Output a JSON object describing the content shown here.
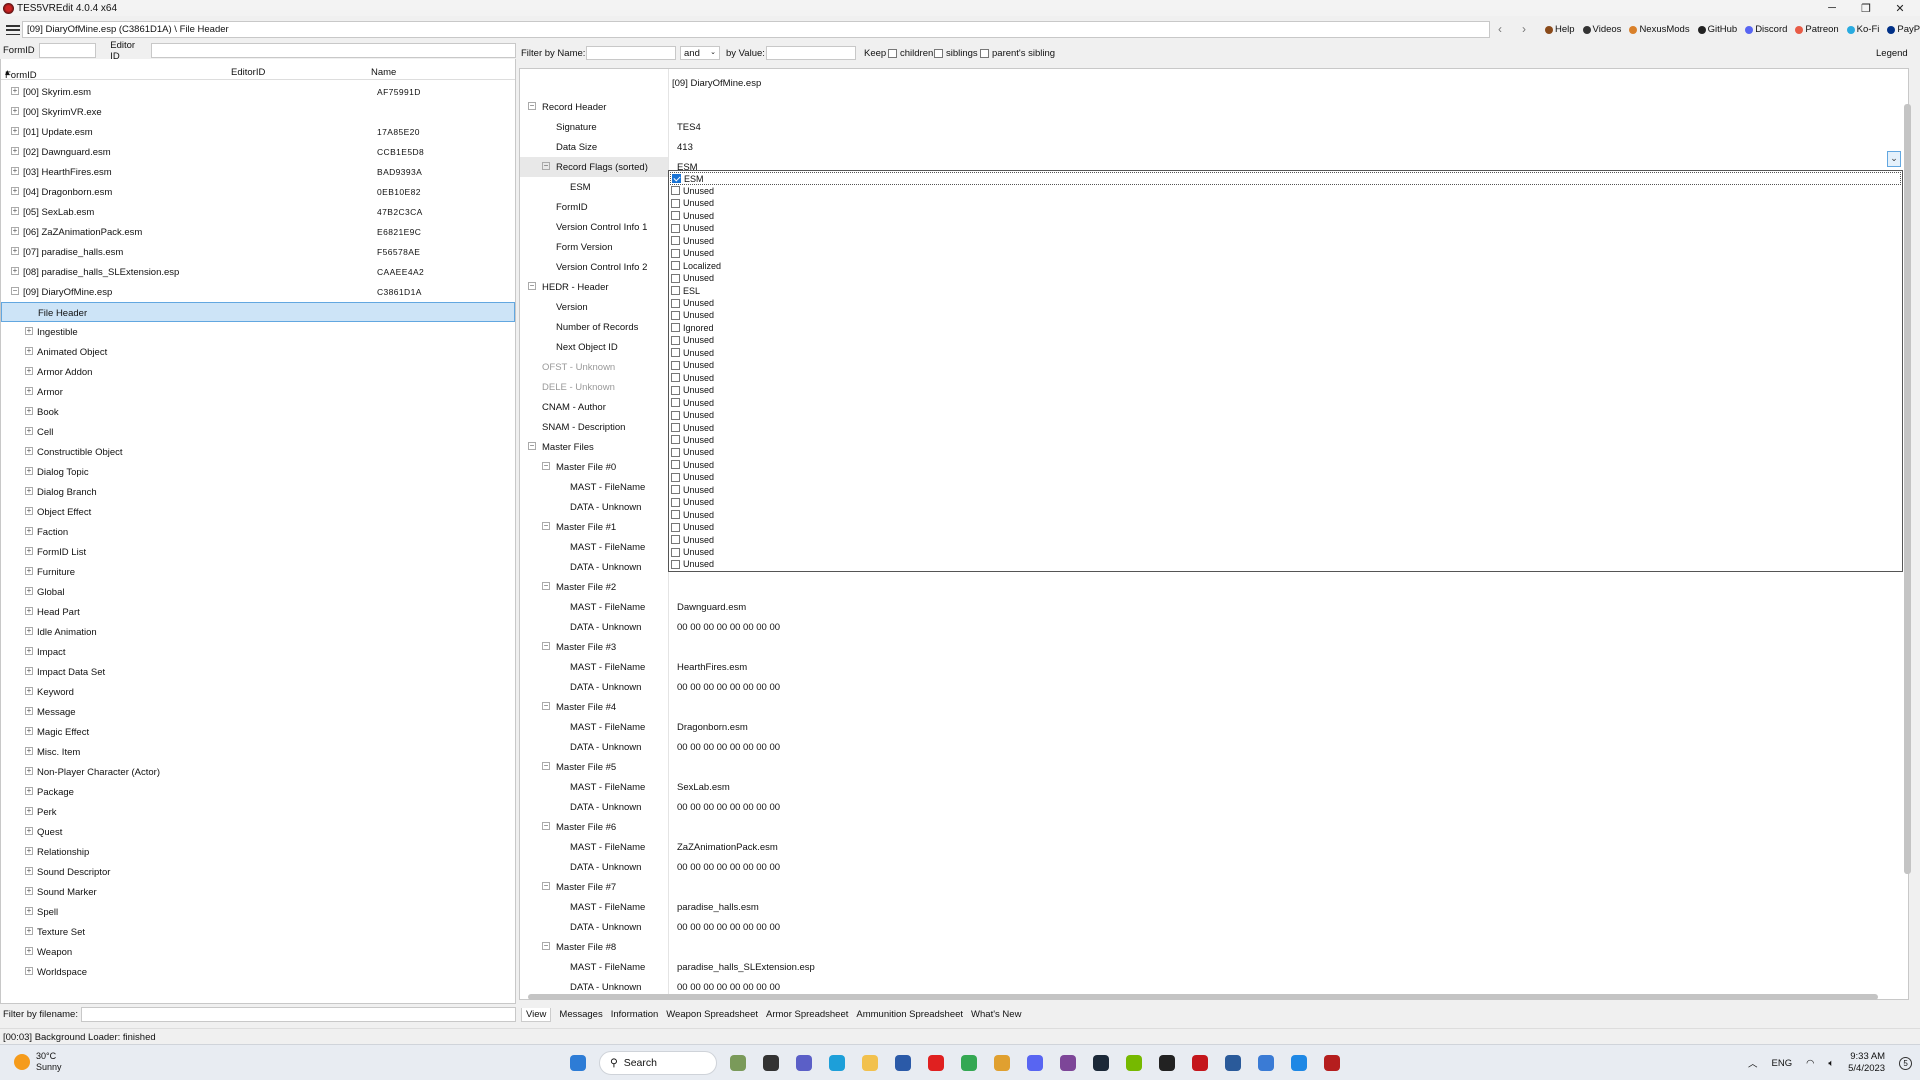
{
  "window": {
    "title": "TES5VREdit 4.0.4 x64"
  },
  "toolbar": {
    "path": "[09] DiaryOfMine.esp (C3861D1A) \\ File Header",
    "links": [
      {
        "label": "Help",
        "icon": "help-icon",
        "color": "#8a4a1a"
      },
      {
        "label": "Videos",
        "icon": "videos-icon",
        "color": "#333333"
      },
      {
        "label": "NexusMods",
        "icon": "nexusmods-icon",
        "color": "#d9802a"
      },
      {
        "label": "GitHub",
        "icon": "github-icon",
        "color": "#222222"
      },
      {
        "label": "Discord",
        "icon": "discord-icon",
        "color": "#5865f2"
      },
      {
        "label": "Patreon",
        "icon": "patreon-icon",
        "color": "#e85b46"
      },
      {
        "label": "Ko-Fi",
        "icon": "kofi-icon",
        "color": "#29abe0"
      },
      {
        "label": "PayPal",
        "icon": "paypal-icon",
        "color": "#003087"
      }
    ]
  },
  "left_filter": {
    "formid_label": "FormID",
    "editorid_label": "Editor ID"
  },
  "left_columns": {
    "formid": "FormID",
    "editorid": "EditorID",
    "name": "Name"
  },
  "tree": [
    {
      "label": "[00] Skyrim.esm",
      "fid": "AF75991D",
      "level": 0,
      "expander": "+"
    },
    {
      "label": "[00] SkyrimVR.exe",
      "fid": "",
      "level": 0,
      "expander": "+"
    },
    {
      "label": "[01] Update.esm",
      "fid": "17A85E20",
      "level": 0,
      "expander": "+"
    },
    {
      "label": "[02] Dawnguard.esm",
      "fid": "CCB1E5D8",
      "level": 0,
      "expander": "+"
    },
    {
      "label": "[03] HearthFires.esm",
      "fid": "BAD9393A",
      "level": 0,
      "expander": "+"
    },
    {
      "label": "[04] Dragonborn.esm",
      "fid": "0EB10E82",
      "level": 0,
      "expander": "+"
    },
    {
      "label": "[05] SexLab.esm",
      "fid": "47B2C3CA",
      "level": 0,
      "expander": "+"
    },
    {
      "label": "[06] ZaZAnimationPack.esm",
      "fid": "E6821E9C",
      "level": 0,
      "expander": "+"
    },
    {
      "label": "[07] paradise_halls.esm",
      "fid": "F56578AE",
      "level": 0,
      "expander": "+"
    },
    {
      "label": "[08] paradise_halls_SLExtension.esp",
      "fid": "CAAEE4A2",
      "level": 0,
      "expander": "+"
    },
    {
      "label": "[09] DiaryOfMine.esp",
      "fid": "C3861D1A",
      "level": 0,
      "expander": "−"
    },
    {
      "label": "File Header",
      "fid": "",
      "level": 1,
      "expander": "",
      "selected": true
    },
    {
      "label": "Ingestible",
      "fid": "",
      "level": 1,
      "expander": "+"
    },
    {
      "label": "Animated Object",
      "fid": "",
      "level": 1,
      "expander": "+"
    },
    {
      "label": "Armor Addon",
      "fid": "",
      "level": 1,
      "expander": "+"
    },
    {
      "label": "Armor",
      "fid": "",
      "level": 1,
      "expander": "+"
    },
    {
      "label": "Book",
      "fid": "",
      "level": 1,
      "expander": "+"
    },
    {
      "label": "Cell",
      "fid": "",
      "level": 1,
      "expander": "+"
    },
    {
      "label": "Constructible Object",
      "fid": "",
      "level": 1,
      "expander": "+"
    },
    {
      "label": "Dialog Topic",
      "fid": "",
      "level": 1,
      "expander": "+"
    },
    {
      "label": "Dialog Branch",
      "fid": "",
      "level": 1,
      "expander": "+"
    },
    {
      "label": "Object Effect",
      "fid": "",
      "level": 1,
      "expander": "+"
    },
    {
      "label": "Faction",
      "fid": "",
      "level": 1,
      "expander": "+"
    },
    {
      "label": "FormID List",
      "fid": "",
      "level": 1,
      "expander": "+"
    },
    {
      "label": "Furniture",
      "fid": "",
      "level": 1,
      "expander": "+"
    },
    {
      "label": "Global",
      "fid": "",
      "level": 1,
      "expander": "+"
    },
    {
      "label": "Head Part",
      "fid": "",
      "level": 1,
      "expander": "+"
    },
    {
      "label": "Idle Animation",
      "fid": "",
      "level": 1,
      "expander": "+"
    },
    {
      "label": "Impact",
      "fid": "",
      "level": 1,
      "expander": "+"
    },
    {
      "label": "Impact Data Set",
      "fid": "",
      "level": 1,
      "expander": "+"
    },
    {
      "label": "Keyword",
      "fid": "",
      "level": 1,
      "expander": "+"
    },
    {
      "label": "Message",
      "fid": "",
      "level": 1,
      "expander": "+"
    },
    {
      "label": "Magic Effect",
      "fid": "",
      "level": 1,
      "expander": "+"
    },
    {
      "label": "Misc. Item",
      "fid": "",
      "level": 1,
      "expander": "+"
    },
    {
      "label": "Non-Player Character (Actor)",
      "fid": "",
      "level": 1,
      "expander": "+"
    },
    {
      "label": "Package",
      "fid": "",
      "level": 1,
      "expander": "+"
    },
    {
      "label": "Perk",
      "fid": "",
      "level": 1,
      "expander": "+"
    },
    {
      "label": "Quest",
      "fid": "",
      "level": 1,
      "expander": "+"
    },
    {
      "label": "Relationship",
      "fid": "",
      "level": 1,
      "expander": "+"
    },
    {
      "label": "Sound Descriptor",
      "fid": "",
      "level": 1,
      "expander": "+"
    },
    {
      "label": "Sound Marker",
      "fid": "",
      "level": 1,
      "expander": "+"
    },
    {
      "label": "Spell",
      "fid": "",
      "level": 1,
      "expander": "+"
    },
    {
      "label": "Texture Set",
      "fid": "",
      "level": 1,
      "expander": "+"
    },
    {
      "label": "Weapon",
      "fid": "",
      "level": 1,
      "expander": "+"
    },
    {
      "label": "Worldspace",
      "fid": "",
      "level": 1,
      "expander": "+"
    }
  ],
  "left_bottom": {
    "filter_label": "Filter by filename:"
  },
  "status": {
    "text": "[00:03] Background Loader: finished"
  },
  "right_filter": {
    "by_name": "Filter by Name:",
    "and": "and",
    "by_value": "by Value:",
    "keep": "Keep",
    "children": "children",
    "siblings": "siblings",
    "parents_sibling": "parent's sibling",
    "legend": "Legend"
  },
  "record": {
    "header_value": "[09] DiaryOfMine.esp",
    "rows": [
      {
        "label": "Record Header",
        "value": "",
        "level": 0,
        "expander": "−"
      },
      {
        "label": "Signature",
        "value": "TES4",
        "level": 1,
        "expander": ""
      },
      {
        "label": "Data Size",
        "value": "413",
        "level": 1,
        "expander": ""
      },
      {
        "label": "Record Flags (sorted)",
        "value": "ESM",
        "level": 1,
        "expander": "−",
        "highlight": true
      },
      {
        "label": "ESM",
        "value": "",
        "level": 2,
        "expander": ""
      },
      {
        "label": "FormID",
        "value": "",
        "level": 1,
        "expander": ""
      },
      {
        "label": "Version Control Info 1",
        "value": "",
        "level": 1,
        "expander": ""
      },
      {
        "label": "Form Version",
        "value": "",
        "level": 1,
        "expander": ""
      },
      {
        "label": "Version Control Info 2",
        "value": "",
        "level": 1,
        "expander": ""
      },
      {
        "label": "HEDR - Header",
        "value": "",
        "level": 0,
        "expander": "−"
      },
      {
        "label": "Version",
        "value": "",
        "level": 1,
        "expander": ""
      },
      {
        "label": "Number of Records",
        "value": "",
        "level": 1,
        "expander": ""
      },
      {
        "label": "Next Object ID",
        "value": "",
        "level": 1,
        "expander": ""
      },
      {
        "label": "OFST - Unknown",
        "value": "",
        "level": 0,
        "expander": "",
        "dim": true
      },
      {
        "label": "DELE - Unknown",
        "value": "",
        "level": 0,
        "expander": "",
        "dim": true
      },
      {
        "label": "CNAM - Author",
        "value": "",
        "level": 0,
        "expander": ""
      },
      {
        "label": "SNAM - Description",
        "value": "",
        "level": 0,
        "expander": ""
      },
      {
        "label": "Master Files",
        "value": "",
        "level": 0,
        "expander": "−"
      },
      {
        "label": "Master File #0",
        "value": "",
        "level": 1,
        "expander": "−"
      },
      {
        "label": "MAST - FileName",
        "value": "",
        "level": 2,
        "expander": ""
      },
      {
        "label": "DATA - Unknown",
        "value": "",
        "level": 2,
        "expander": ""
      },
      {
        "label": "Master File #1",
        "value": "",
        "level": 1,
        "expander": "−"
      },
      {
        "label": "MAST - FileName",
        "value": "",
        "level": 2,
        "expander": ""
      },
      {
        "label": "DATA - Unknown",
        "value": "",
        "level": 2,
        "expander": ""
      },
      {
        "label": "Master File #2",
        "value": "",
        "level": 1,
        "expander": "−"
      },
      {
        "label": "MAST - FileName",
        "value": "Dawnguard.esm",
        "level": 2,
        "expander": ""
      },
      {
        "label": "DATA - Unknown",
        "value": "00 00 00 00 00 00 00 00",
        "level": 2,
        "expander": ""
      },
      {
        "label": "Master File #3",
        "value": "",
        "level": 1,
        "expander": "−"
      },
      {
        "label": "MAST - FileName",
        "value": "HearthFires.esm",
        "level": 2,
        "expander": ""
      },
      {
        "label": "DATA - Unknown",
        "value": "00 00 00 00 00 00 00 00",
        "level": 2,
        "expander": ""
      },
      {
        "label": "Master File #4",
        "value": "",
        "level": 1,
        "expander": "−"
      },
      {
        "label": "MAST - FileName",
        "value": "Dragonborn.esm",
        "level": 2,
        "expander": ""
      },
      {
        "label": "DATA - Unknown",
        "value": "00 00 00 00 00 00 00 00",
        "level": 2,
        "expander": ""
      },
      {
        "label": "Master File #5",
        "value": "",
        "level": 1,
        "expander": "−"
      },
      {
        "label": "MAST - FileName",
        "value": "SexLab.esm",
        "level": 2,
        "expander": ""
      },
      {
        "label": "DATA - Unknown",
        "value": "00 00 00 00 00 00 00 00",
        "level": 2,
        "expander": ""
      },
      {
        "label": "Master File #6",
        "value": "",
        "level": 1,
        "expander": "−"
      },
      {
        "label": "MAST - FileName",
        "value": "ZaZAnimationPack.esm",
        "level": 2,
        "expander": ""
      },
      {
        "label": "DATA - Unknown",
        "value": "00 00 00 00 00 00 00 00",
        "level": 2,
        "expander": ""
      },
      {
        "label": "Master File #7",
        "value": "",
        "level": 1,
        "expander": "−"
      },
      {
        "label": "MAST - FileName",
        "value": "paradise_halls.esm",
        "level": 2,
        "expander": ""
      },
      {
        "label": "DATA - Unknown",
        "value": "00 00 00 00 00 00 00 00",
        "level": 2,
        "expander": ""
      },
      {
        "label": "Master File #8",
        "value": "",
        "level": 1,
        "expander": "−"
      },
      {
        "label": "MAST - FileName",
        "value": "paradise_halls_SLExtension.esp",
        "level": 2,
        "expander": ""
      },
      {
        "label": "DATA - Unknown",
        "value": "00 00 00 00 00 00 00 00",
        "level": 2,
        "expander": ""
      }
    ]
  },
  "flags": [
    {
      "label": "ESM",
      "checked": true
    },
    {
      "label": "Unused",
      "checked": false
    },
    {
      "label": "Unused",
      "checked": false
    },
    {
      "label": "Unused",
      "checked": false
    },
    {
      "label": "Unused",
      "checked": false
    },
    {
      "label": "Unused",
      "checked": false
    },
    {
      "label": "Unused",
      "checked": false
    },
    {
      "label": "Localized",
      "checked": false
    },
    {
      "label": "Unused",
      "checked": false
    },
    {
      "label": "ESL",
      "checked": false
    },
    {
      "label": "Unused",
      "checked": false
    },
    {
      "label": "Unused",
      "checked": false
    },
    {
      "label": "Ignored",
      "checked": false
    },
    {
      "label": "Unused",
      "checked": false
    },
    {
      "label": "Unused",
      "checked": false
    },
    {
      "label": "Unused",
      "checked": false
    },
    {
      "label": "Unused",
      "checked": false
    },
    {
      "label": "Unused",
      "checked": false
    },
    {
      "label": "Unused",
      "checked": false
    },
    {
      "label": "Unused",
      "checked": false
    },
    {
      "label": "Unused",
      "checked": false
    },
    {
      "label": "Unused",
      "checked": false
    },
    {
      "label": "Unused",
      "checked": false
    },
    {
      "label": "Unused",
      "checked": false
    },
    {
      "label": "Unused",
      "checked": false
    },
    {
      "label": "Unused",
      "checked": false
    },
    {
      "label": "Unused",
      "checked": false
    },
    {
      "label": "Unused",
      "checked": false
    },
    {
      "label": "Unused",
      "checked": false
    },
    {
      "label": "Unused",
      "checked": false
    },
    {
      "label": "Unused",
      "checked": false
    },
    {
      "label": "Unused",
      "checked": false
    }
  ],
  "bottom_tabs": [
    "View",
    "Messages",
    "Information",
    "Weapon Spreadsheet",
    "Armor Spreadsheet",
    "Ammunition Spreadsheet",
    "What's New"
  ],
  "taskbar": {
    "temp": "30°C",
    "weather": "Sunny",
    "search_label": "Search",
    "lang": "ENG",
    "time": "9:33 AM",
    "date": "5/4/2023",
    "notif_count": "5",
    "apps": [
      {
        "name": "windows-start-icon",
        "color": "#2d7cd6"
      },
      {
        "name": "search-box"
      },
      {
        "name": "landscape-icon",
        "color": "#7a9a5a"
      },
      {
        "name": "task-view-icon",
        "color": "#333333"
      },
      {
        "name": "teams-chat-icon",
        "color": "#5b5fc7"
      },
      {
        "name": "edge-icon",
        "color": "#1d9fd9"
      },
      {
        "name": "file-explorer-icon",
        "color": "#f2c14e"
      },
      {
        "name": "store-icon",
        "color": "#2b5aa8"
      },
      {
        "name": "opera-icon",
        "color": "#e02020"
      },
      {
        "name": "chrome-icon",
        "color": "#34a853"
      },
      {
        "name": "folder-icon",
        "color": "#e0a030"
      },
      {
        "name": "discord-app-icon",
        "color": "#5865f2"
      },
      {
        "name": "tor-icon",
        "color": "#7d4698"
      },
      {
        "name": "steam-icon",
        "color": "#1b2838"
      },
      {
        "name": "nvidia-icon",
        "color": "#76b900"
      },
      {
        "name": "terminal-icon",
        "color": "#222222"
      },
      {
        "name": "adobe-icon",
        "color": "#c4161c"
      },
      {
        "name": "vr-icon",
        "color": "#2a5a9a"
      },
      {
        "name": "photos-icon",
        "color": "#3a7bd5"
      },
      {
        "name": "bing-icon",
        "color": "#1e88e5"
      },
      {
        "name": "tes5vredit-icon",
        "color": "#b51e1e"
      }
    ]
  }
}
